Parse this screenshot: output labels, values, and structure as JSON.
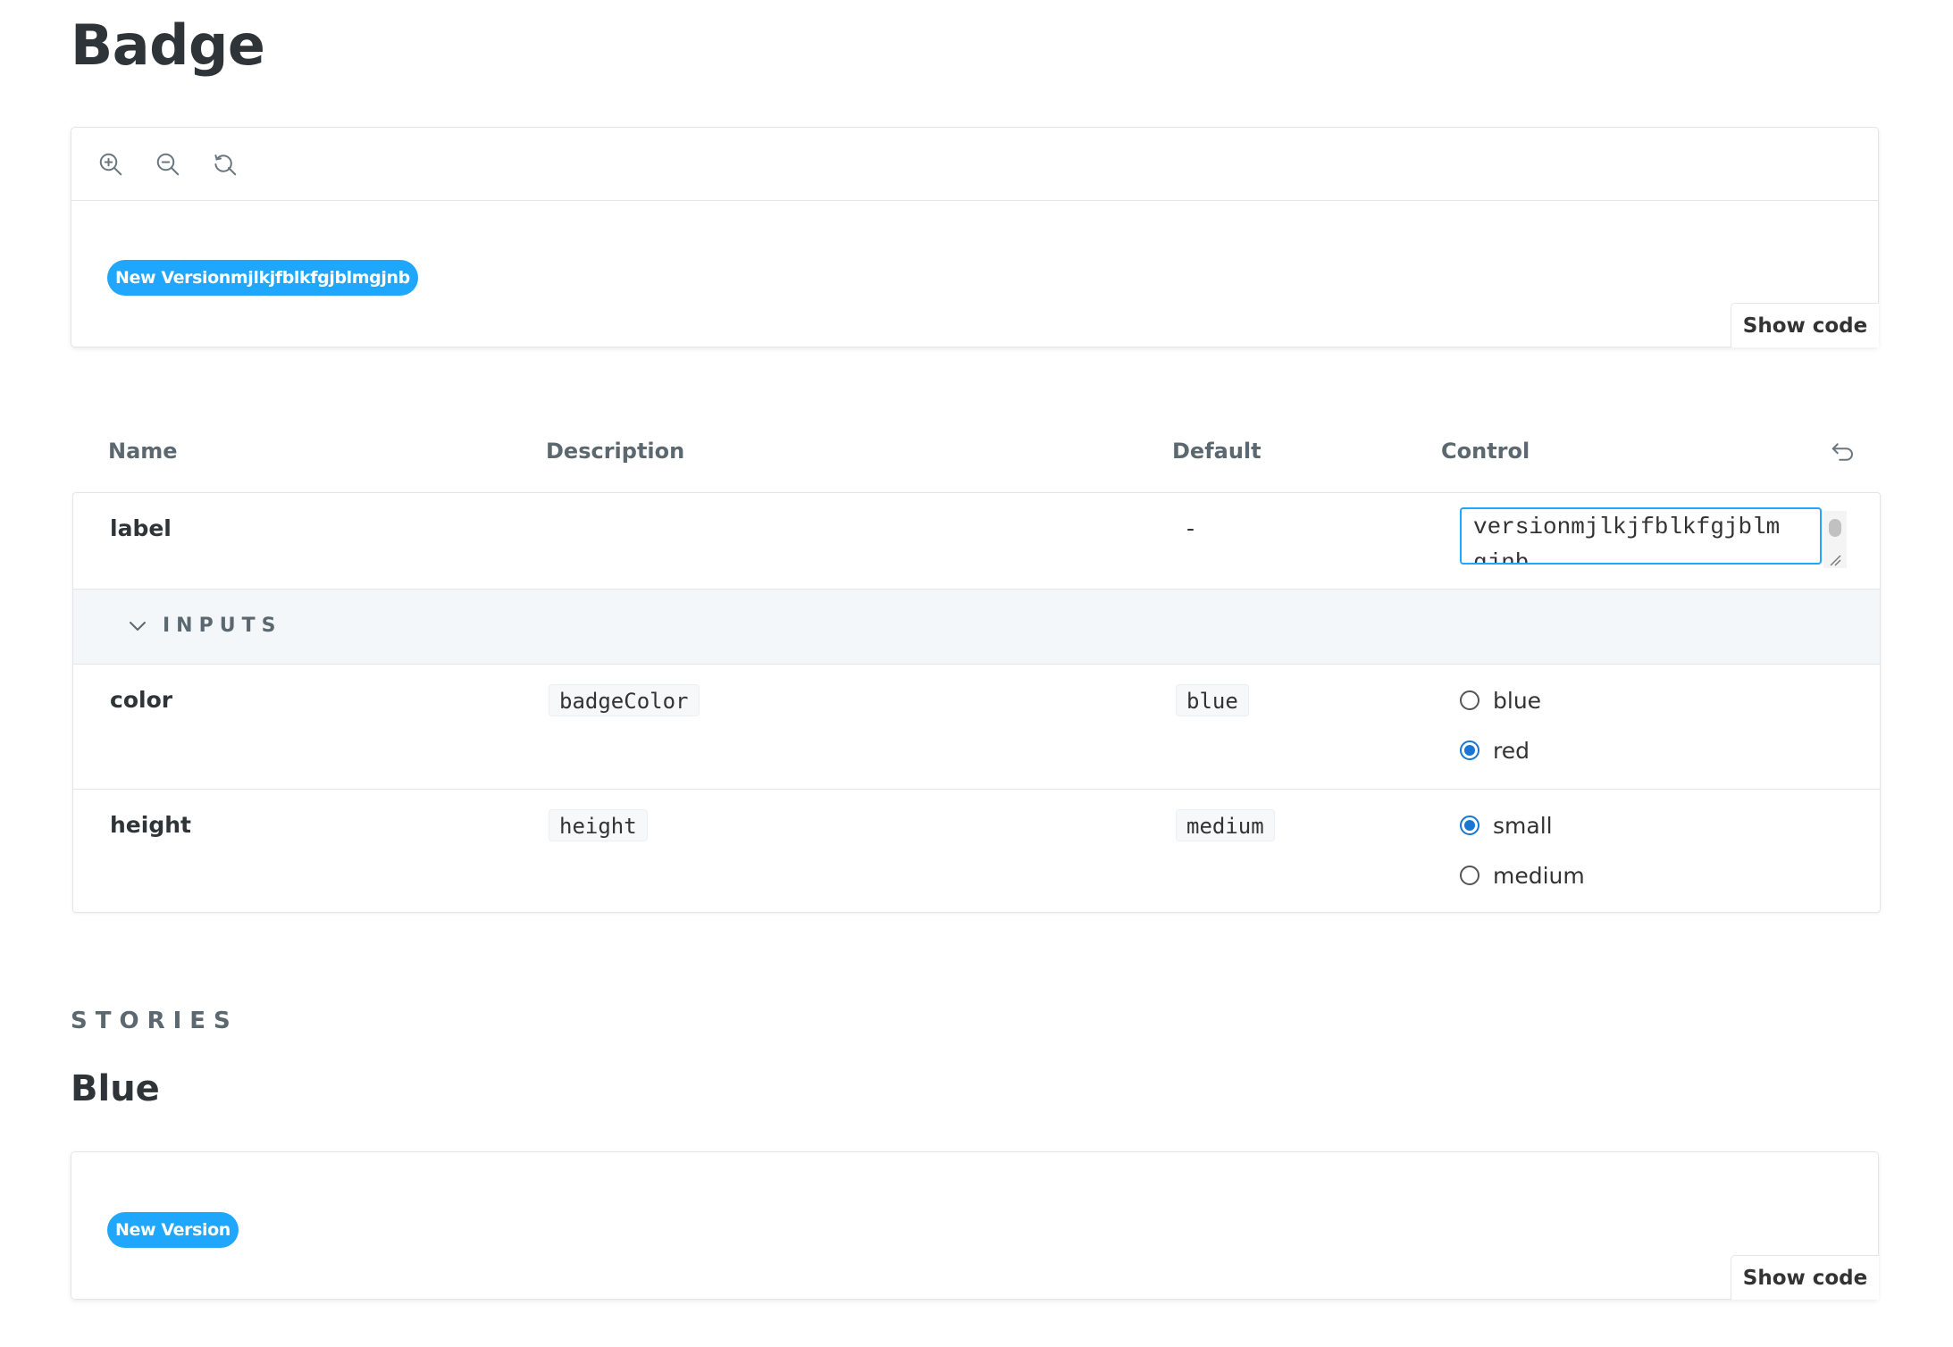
{
  "page": {
    "title": "Badge"
  },
  "preview": {
    "badge_text": "New Versionmjlkjfblkfgjblmgjnb",
    "badge_color": "#1ea7fd",
    "show_code_label": "Show code",
    "toolbar_icons": [
      "zoom-in-icon",
      "zoom-out-icon",
      "zoom-reset-icon"
    ]
  },
  "args_table": {
    "headers": {
      "name": "Name",
      "description": "Description",
      "default": "Default",
      "control": "Control"
    },
    "reset_icon": "undo-icon",
    "label_row": {
      "name": "label",
      "default": "-",
      "value": "versionmjlkjfblkfgjblm\ngjnb"
    },
    "section": {
      "label": "INPUTS",
      "icon": "chevron-down-icon"
    },
    "color_row": {
      "name": "color",
      "description": "badgeColor",
      "default": "blue",
      "options": [
        "blue",
        "red"
      ],
      "selected": "red"
    },
    "height_row": {
      "name": "height",
      "description": "height",
      "default": "medium",
      "options": [
        "small",
        "medium"
      ],
      "selected": "small"
    }
  },
  "stories": {
    "section_label": "STORIES",
    "items": [
      {
        "title": "Blue",
        "badge_text": "New Version",
        "show_code_label": "Show code"
      }
    ]
  },
  "colors": {
    "accent": "#1ea7fd",
    "radio_checked": "#1976d2",
    "section_bg": "#f4f7fa"
  }
}
